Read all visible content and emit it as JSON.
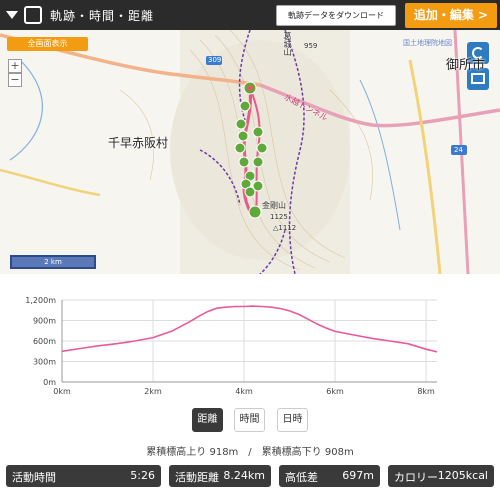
{
  "header": {
    "title": "軌跡・時間・距離",
    "download_label": "軌跡データをダウンロード",
    "edit_label": "追加・編集 >"
  },
  "map": {
    "fullscreen_label": "全画面表示",
    "zoom_in": "+",
    "zoom_out": "−",
    "scale_label": "2 km",
    "attribution": "国土地理院地図",
    "labels": {
      "village": "千早赤阪村",
      "city": "御所市",
      "katsuragi": "葛城山",
      "kongo": "金剛山",
      "mizukoshi": "水越トンネル",
      "peak_959": "959",
      "peak_1125": "1125",
      "peak_1112": "△1112",
      "route_309": "309",
      "route_24": "24"
    },
    "colors": {
      "track": "#e85a8a",
      "marker": "#5fa83a",
      "road_major": "#f2b38a",
      "road_national": "#e8a0b8"
    }
  },
  "chart_data": {
    "type": "line",
    "x": [
      0,
      0.4,
      0.8,
      1.2,
      1.6,
      2.0,
      2.4,
      2.8,
      3.0,
      3.2,
      3.4,
      3.6,
      3.8,
      4.0,
      4.2,
      4.4,
      4.6,
      4.8,
      5.0,
      5.2,
      5.4,
      5.6,
      5.8,
      6.0,
      6.4,
      6.8,
      7.2,
      7.6,
      8.0,
      8.24
    ],
    "y": [
      450,
      490,
      530,
      560,
      600,
      650,
      740,
      880,
      960,
      1030,
      1080,
      1095,
      1105,
      1105,
      1110,
      1105,
      1095,
      1075,
      1040,
      990,
      920,
      850,
      790,
      740,
      690,
      640,
      600,
      560,
      480,
      440
    ],
    "xlabel": "",
    "ylabel": "",
    "xlim": [
      0,
      8.24
    ],
    "ylim": [
      0,
      1200
    ],
    "xticks": [
      "0km",
      "2km",
      "4km",
      "6km",
      "8km"
    ],
    "yticks": [
      "0m",
      "300m",
      "600m",
      "900m",
      "1,200m"
    ],
    "color": "#e85a9a"
  },
  "tabs": [
    {
      "label": "距離",
      "active": true
    },
    {
      "label": "時間",
      "active": false
    },
    {
      "label": "日時",
      "active": false
    }
  ],
  "gain_loss": "累積標高上り 918m　/　累積標高下り 908m",
  "stats": {
    "time": {
      "label": "活動時間",
      "value": "5:26"
    },
    "distance": {
      "label": "活動距離",
      "value": "8.24km"
    },
    "elevation": {
      "label": "高低差",
      "value": "697m"
    },
    "calorie": {
      "label": "カロリー",
      "value": "1205kcal"
    }
  }
}
